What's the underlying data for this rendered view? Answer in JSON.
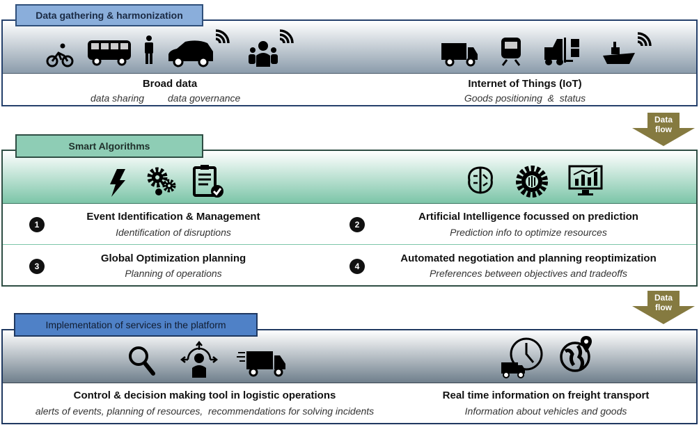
{
  "section1": {
    "tab": "Data gathering & harmonization",
    "left_title": "Broad data",
    "left_sub1": "data sharing",
    "left_sub2": "data governance",
    "right_title": "Internet of Things (IoT)",
    "right_sub": "Goods positioning  &  status",
    "colors": {
      "tab": "#8aaedb",
      "border": "#24406b"
    }
  },
  "flow1": {
    "line1": "Data",
    "line2": "flow"
  },
  "section2": {
    "tab": "Smart Algorithms",
    "items": [
      {
        "number": "1",
        "title": "Event Identification & Management",
        "sub": "Identification of  disruptions"
      },
      {
        "number": "2",
        "title": "Artificial Intelligence focussed on prediction",
        "sub": "Prediction info to optimize resources"
      },
      {
        "number": "3",
        "title": "Global Optimization planning",
        "sub": "Planning of operations"
      },
      {
        "number": "4",
        "title": "Automated negotiation and planning reoptimization",
        "sub": "Preferences between objectives and tradeoffs"
      }
    ],
    "colors": {
      "tab": "#8ecdb5",
      "border": "#2e4d43"
    }
  },
  "flow2": {
    "line1": "Data",
    "line2": "flow"
  },
  "section3": {
    "tab": "Implementation of services in the platform",
    "left_title": "Control & decision making tool in logistic operations",
    "left_sub": "alerts of events, planning of resources,  recommendations for solving incidents",
    "right_title": "Real time information on freight transport",
    "right_sub": "Information about vehicles and goods",
    "colors": {
      "tab": "#4f81c7",
      "border": "#1f3860"
    }
  },
  "arrow_color": "#857a40"
}
